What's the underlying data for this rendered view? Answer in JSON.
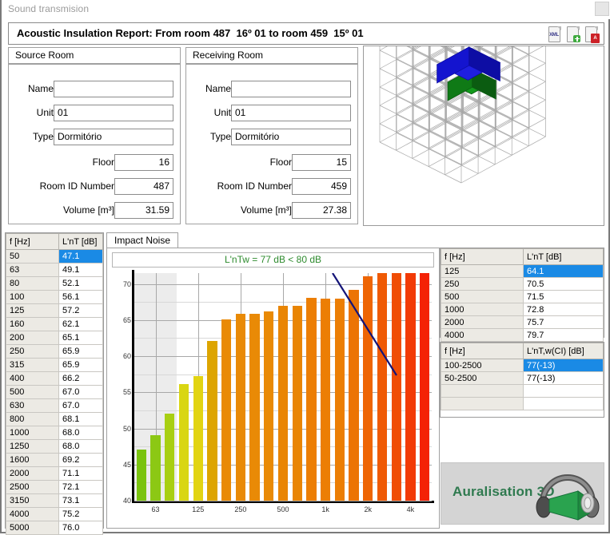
{
  "window": {
    "strip_title": "Sound transmision",
    "report_title": "Acoustic Insulation Report: From room 487  16º 01 to room 459  15º 01",
    "icons": [
      {
        "name": "export-xml-icon",
        "label": "XML"
      },
      {
        "name": "new-document-icon",
        "label": ""
      },
      {
        "name": "export-pdf-icon",
        "label": "A"
      }
    ]
  },
  "source_room": {
    "legend": "Source Room",
    "fields": [
      {
        "label": "Name",
        "value": "",
        "align": "left"
      },
      {
        "label": "Unit",
        "value": "01",
        "align": "left"
      },
      {
        "label": "Type",
        "value": "Dormitório",
        "align": "left"
      },
      {
        "label": "Floor",
        "value": "16",
        "align": "right"
      },
      {
        "label": "Room ID Number",
        "value": "487",
        "align": "right"
      },
      {
        "label": "Volume [m³]",
        "value": "31.59",
        "align": "right"
      }
    ]
  },
  "receiving_room": {
    "legend": "Receiving Room",
    "fields": [
      {
        "label": "Name",
        "value": "",
        "align": "left"
      },
      {
        "label": "Unit",
        "value": "01",
        "align": "left"
      },
      {
        "label": "Type",
        "value": "Dormitório",
        "align": "left"
      },
      {
        "label": "Floor",
        "value": "15",
        "align": "right"
      },
      {
        "label": "Room ID Number",
        "value": "459",
        "align": "right"
      },
      {
        "label": "Volume [m³]",
        "value": "27.38",
        "align": "right"
      }
    ]
  },
  "view3d": {
    "name": "building-3d-wireframe-view",
    "source_room_color": "#1414cf",
    "receiving_room_color": "#0f7a16",
    "wire_color": "#a8a8a8"
  },
  "third_octave_table": {
    "headers": [
      "f [Hz]",
      "L'nT [dB]"
    ],
    "selected_row": 0,
    "rows": [
      [
        "50",
        "47.1"
      ],
      [
        "63",
        "49.1"
      ],
      [
        "80",
        "52.1"
      ],
      [
        "100",
        "56.1"
      ],
      [
        "125",
        "57.2"
      ],
      [
        "160",
        "62.1"
      ],
      [
        "200",
        "65.1"
      ],
      [
        "250",
        "65.9"
      ],
      [
        "315",
        "65.9"
      ],
      [
        "400",
        "66.2"
      ],
      [
        "500",
        "67.0"
      ],
      [
        "630",
        "67.0"
      ],
      [
        "800",
        "68.1"
      ],
      [
        "1000",
        "68.0"
      ],
      [
        "1250",
        "68.0"
      ],
      [
        "1600",
        "69.2"
      ],
      [
        "2000",
        "71.1"
      ],
      [
        "2500",
        "72.1"
      ],
      [
        "3150",
        "73.1"
      ],
      [
        "4000",
        "75.2"
      ],
      [
        "5000",
        "76.0"
      ]
    ]
  },
  "octave_table": {
    "headers": [
      "f [Hz]",
      "L'nT [dB]"
    ],
    "selected_row": 0,
    "rows": [
      [
        "125",
        "64.1"
      ],
      [
        "250",
        "70.5"
      ],
      [
        "500",
        "71.5"
      ],
      [
        "1000",
        "72.8"
      ],
      [
        "2000",
        "75.7"
      ],
      [
        "4000",
        "79.7"
      ]
    ]
  },
  "single_number_table": {
    "headers": [
      "f [Hz]",
      "L'nT,w(CI) [dB]"
    ],
    "selected_row": 0,
    "rows": [
      [
        "100-2500",
        "77(-13)"
      ],
      [
        "50-2500",
        "77(-13)"
      ],
      [
        "",
        ""
      ],
      [
        "",
        ""
      ]
    ]
  },
  "chart_panel": {
    "tab_label": "Impact Noise",
    "caption": "L'nTw = 77 dB < 80 dB",
    "caption_color": "#2e8b2e"
  },
  "logo": {
    "text": "Auralisation 3D",
    "icon_name": "headphones-icon"
  },
  "chart_data": {
    "type": "bar",
    "title": "L'nTw = 77 dB < 80 dB",
    "xlabel": "",
    "ylabel": "",
    "ylim": [
      40,
      71.5
    ],
    "yticks": [
      40,
      45,
      50,
      55,
      60,
      65,
      70
    ],
    "yticks_minor": [
      42.5,
      47.5,
      52.5,
      57.5,
      62.5,
      67.5
    ],
    "grid": true,
    "categories": [
      "50",
      "63",
      "80",
      "100",
      "125",
      "160",
      "200",
      "250",
      "315",
      "400",
      "500",
      "630",
      "800",
      "1000",
      "1250",
      "1600",
      "2000",
      "2500",
      "3150",
      "4000",
      "5000"
    ],
    "xtick_labels": [
      "63",
      "125",
      "250",
      "500",
      "1k",
      "2k",
      "4k"
    ],
    "xtick_categories": [
      "63",
      "125",
      "250",
      "500",
      "1000",
      "2000",
      "4000"
    ],
    "values": [
      47.1,
      49.1,
      52.1,
      56.1,
      57.2,
      62.1,
      65.1,
      65.9,
      65.9,
      66.2,
      67.0,
      67.0,
      68.1,
      68.0,
      68.0,
      69.2,
      71.1,
      72.1,
      73.1,
      75.2,
      76.0
    ],
    "bar_colors": [
      "#7ac30f",
      "#8cc814",
      "#a8cf12",
      "#d9d612",
      "#e2d412",
      "#dda500",
      "#e98a06",
      "#e98a06",
      "#e98a06",
      "#e98a06",
      "#e98504",
      "#e98504",
      "#ec7e04",
      "#ec7e04",
      "#ec7e04",
      "#ec7404",
      "#ee6504",
      "#ef5a05",
      "#f04d05",
      "#f23a06",
      "#f42206"
    ],
    "shaded_band": {
      "from_category": "50",
      "to_category": "80",
      "color": "#ececec"
    },
    "reference_curve": {
      "name": "ISO rating reference curve",
      "color": "#141478",
      "points": [
        [
          380,
          71.3
        ],
        [
          395,
          70.6
        ],
        [
          410,
          69.9
        ]
      ],
      "drawn_from_category": "2000",
      "drawn_to_category": "3150"
    }
  }
}
